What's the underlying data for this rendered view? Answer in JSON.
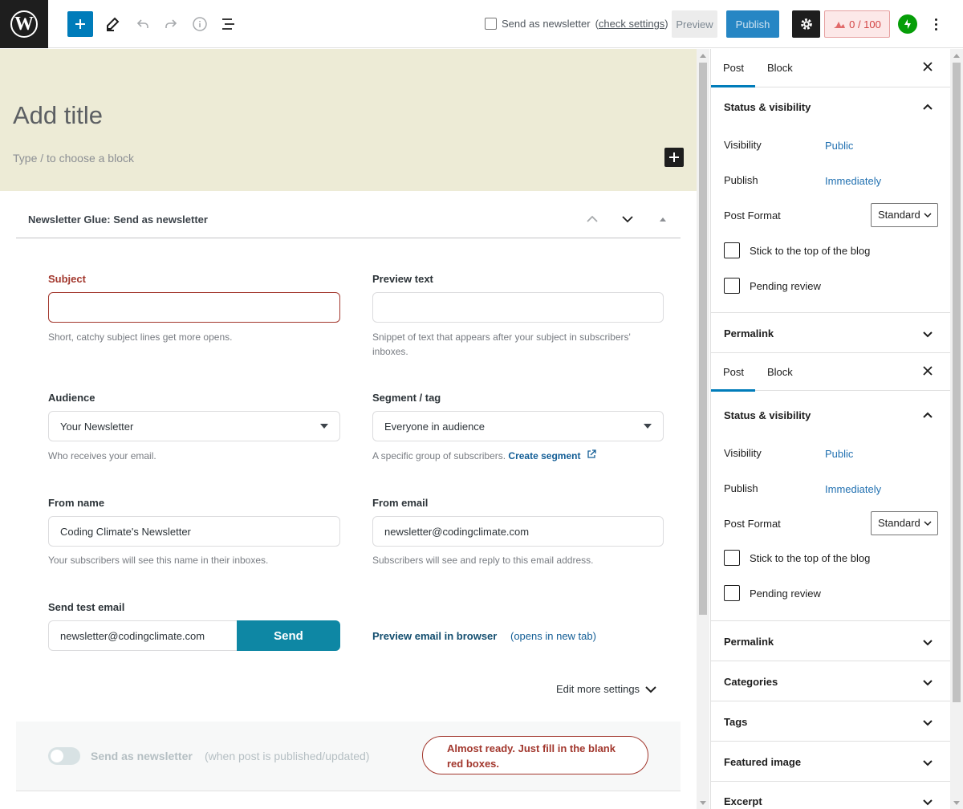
{
  "toolbar": {
    "logo_letter": "W",
    "newsletter_checkbox_label": "Send as newsletter",
    "check_settings_link": "check settings",
    "preview_label": "Preview",
    "publish_label": "Publish",
    "score_label": "0 / 100",
    "icons": [
      "wordpress-logo",
      "plus-icon",
      "pencil-icon",
      "undo-icon",
      "redo-icon",
      "info-icon",
      "list-view-icon",
      "gear-icon",
      "score-icon",
      "jetpack-icon",
      "kebab-icon"
    ]
  },
  "editor": {
    "title_placeholder": "Add title",
    "block_hint": "Type / to choose a block",
    "panel_title": "Newsletter Glue: Send as newsletter",
    "subject": {
      "label": "Subject",
      "value": "",
      "help": "Short, catchy subject lines get more opens."
    },
    "preview_text": {
      "label": "Preview text",
      "value": "",
      "help": "Snippet of text that appears after your subject in subscribers' inboxes."
    },
    "audience": {
      "label": "Audience",
      "value": "Your Newsletter",
      "help": "Who receives your email."
    },
    "segment": {
      "label": "Segment / tag",
      "value": "Everyone in audience",
      "help": "A specific group of subscribers.",
      "link": "Create segment"
    },
    "from_name": {
      "label": "From name",
      "value": "Coding Climate's Newsletter",
      "help": "Your subscribers will see this name in their inboxes."
    },
    "from_email": {
      "label": "From email",
      "value": "newsletter@codingclimate.com",
      "help": "Subscribers will see and reply to this email address."
    },
    "test_email": {
      "label": "Send test email",
      "value": "newsletter@codingclimate.com",
      "button": "Send"
    },
    "preview_browser_link": "Preview email in browser",
    "preview_browser_note": "(opens in new tab)",
    "edit_more": "Edit more settings",
    "toggle_label": "Send as newsletter",
    "toggle_note": "(when post is published/updated)",
    "toggle_on": false,
    "alert": "Almost ready. Just fill in the blank red boxes.",
    "alert_line1": "Almost ready. Just fill in the blank",
    "alert_line2": "red boxes."
  },
  "sidebar": {
    "tab_post": "Post",
    "tab_block": "Block",
    "status_title": "Status & visibility",
    "visibility_label": "Visibility",
    "visibility_value": "Public",
    "publish_label": "Publish",
    "publish_value": "Immediately",
    "format_label": "Post Format",
    "format_value": "Standard",
    "sticky_label": "Stick to the top of the blog",
    "pending_label": "Pending review",
    "permalink": "Permalink",
    "categories": "Categories",
    "tags": "Tags",
    "featured_image": "Featured image",
    "excerpt": "Excerpt"
  },
  "colors": {
    "accent": "#007cba",
    "title_bg": "#edebd6",
    "error": "#a2372d",
    "send_button": "#0e87a4",
    "jetpack": "#069e08"
  }
}
